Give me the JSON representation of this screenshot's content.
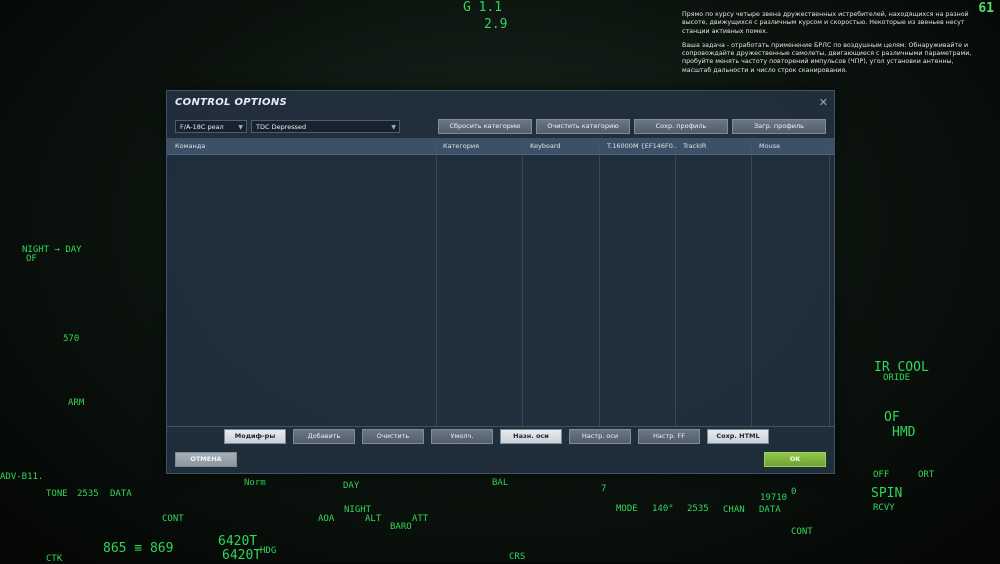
{
  "mission": {
    "paragraph1": "Прямо по курсу четыре звена дружественных истребителей, находящихся на разной высоте, движущихся с различным курсом и скоростью. Некоторые из звеньев несут станции активных помех.",
    "paragraph2": "Ваша задача - отработать применение БРЛС по воздушным целям. Обнаруживайте и сопровождайте дружественные самолеты, двигающиеся с различными параметрами, пробуйте менять частоту повторений импульсов (ЧПР), угол установки антенны, масштаб дальности и число строк сканирования."
  },
  "hud": {
    "corner_value": "61",
    "g_readout": "G  1.1",
    "g_value": "2.9",
    "night_day": "NIGHT → DAY",
    "of": "OF",
    "altitude_marker": "570",
    "arm": "ARM",
    "tone": "TONE",
    "data_left": "DATA",
    "ir_cool": "IR COOL",
    "oride": "ORIDE",
    "of_right": "OF",
    "hmd": "HMD",
    "spin": "SPIN",
    "rcvy": "RCVY",
    "off": "OFF",
    "ort": "ORT",
    "bottom_19710": "19710",
    "bottom_2535": "2535",
    "chan": "CHAN",
    "data": "DATA",
    "cont": "CONT",
    "alt": "ALT",
    "att": "ATT",
    "baro": "BARO",
    "day": "DAY",
    "night": "NIGHT",
    "hdg": "HDG",
    "crs": "CRS",
    "bal": "BAL",
    "norm": "Norm",
    "aoa": "AOA",
    "values_left": "865 ≡ 869",
    "values_left2": "6420T",
    "values_left3": "6420T",
    "arv_ref": "ADV-B11.",
    "ctk": "CTK",
    "mode": "MODE",
    "mode_val": "140°",
    "val_0": "0",
    "val_7": "7",
    "val_2535b": "2535"
  },
  "dialog": {
    "title": "CONTROL OPTIONS",
    "close_label": "✕",
    "aircraft_select": "F/A-18C реал",
    "category_select": "TDC Depressed",
    "top_buttons": {
      "reset_category": "Сбросить категорию",
      "clear_category": "Очистить категорию",
      "save_profile": "Сохр. профиль",
      "load_profile": "Загр. профиль"
    },
    "columns": [
      "Команда",
      "Категория",
      "Keyboard",
      "T.16000M {EF146F0...",
      "TrackIR",
      "Mouse"
    ],
    "bottom_buttons": {
      "modifiers": "Модиф-ры",
      "add": "Добавить",
      "clear": "Очистить",
      "default": "Умолч.",
      "axis_assign": "Назн. оси",
      "axis_tune": "Настр. оси",
      "ff_tune": "Настр. FF",
      "save_html": "Сохр. HTML"
    },
    "cancel": "ОТМЕНА",
    "ok": "OK"
  }
}
